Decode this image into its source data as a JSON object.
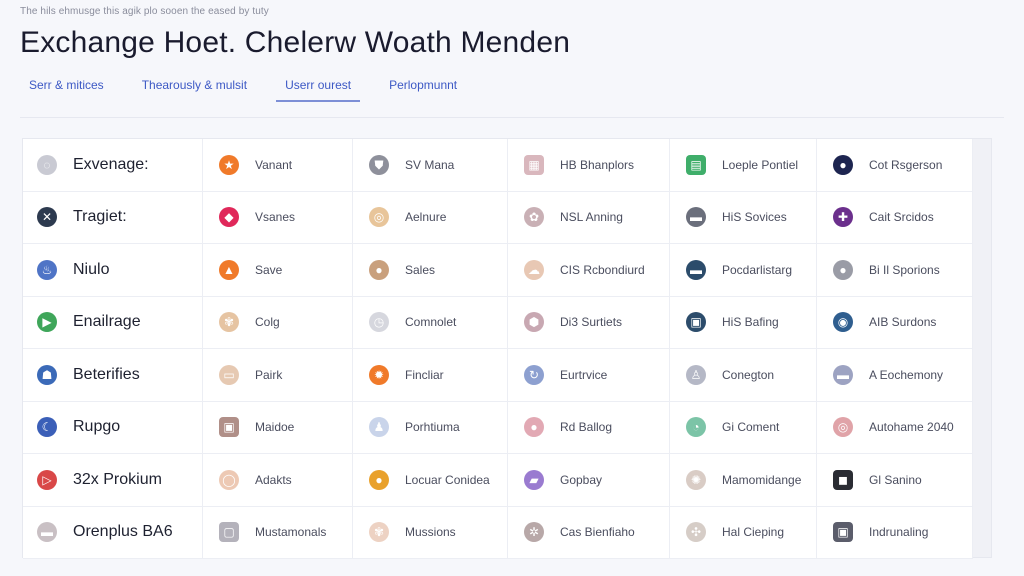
{
  "header": {
    "breadcrumb": "The hils ehmusge this agik plo sooen the eased by tuty",
    "title": "Exchange Hoet. Chelerw Woath Menden"
  },
  "tabs": [
    {
      "label": "Serr & mitices",
      "active": false
    },
    {
      "label": "Thearously & mulsit",
      "active": false
    },
    {
      "label": "Userr ourest",
      "active": true
    },
    {
      "label": "Perlopmunnt",
      "active": false
    }
  ],
  "colors": {
    "accent": "#3d59c5",
    "tab_underline": "#7d8fd6",
    "background": "#f6f7fb",
    "cell": "#ffffff"
  },
  "rows": [
    [
      {
        "label": "Exvenage:",
        "icon": "spinner-icon",
        "color": "#c9cad3",
        "glyph": "◌"
      },
      {
        "label": "Vanant",
        "icon": "star-icon",
        "color": "#f07a2a",
        "glyph": "★"
      },
      {
        "label": "SV Mana",
        "icon": "shield-icon",
        "color": "#8e909b",
        "glyph": "⛊"
      },
      {
        "label": "HB Bhanplors",
        "icon": "grid-icon",
        "color": "#d9b7bd",
        "glyph": "▦"
      },
      {
        "label": "Loeple Pontiel",
        "icon": "document-icon",
        "color": "#3fae6a",
        "glyph": "▤"
      },
      {
        "label": "Cot Rsgerson",
        "icon": "globe-icon",
        "color": "#1d2550",
        "glyph": "●"
      }
    ],
    [
      {
        "label": "Tragiet:",
        "icon": "close-circle-icon",
        "color": "#2d3a4f",
        "glyph": "✕"
      },
      {
        "label": "Vsanes",
        "icon": "gem-icon",
        "color": "#e0285a",
        "glyph": "◆"
      },
      {
        "label": "Aelnure",
        "icon": "compass-icon",
        "color": "#e8c59a",
        "glyph": "◎"
      },
      {
        "label": "NSL Anning",
        "icon": "badge-icon",
        "color": "#c9b0b5",
        "glyph": "✿"
      },
      {
        "label": "HiS Sovices",
        "icon": "pill-icon",
        "color": "#6b6f7c",
        "glyph": "▬"
      },
      {
        "label": "Cait Srcidos",
        "icon": "puzzle-icon",
        "color": "#6b2f8c",
        "glyph": "✚"
      }
    ],
    [
      {
        "label": "Niulo",
        "icon": "leaf-icon",
        "color": "#4f74c6",
        "glyph": "♨"
      },
      {
        "label": "Save",
        "icon": "triangle-icon",
        "color": "#f07a2a",
        "glyph": "▲"
      },
      {
        "label": "Sales",
        "icon": "coin-icon",
        "color": "#c9a07d",
        "glyph": "●"
      },
      {
        "label": "CIS Rcbondiurd",
        "icon": "cloud-icon",
        "color": "#e8c8b4",
        "glyph": "☁"
      },
      {
        "label": "Pocdarlistarg",
        "icon": "disc-icon",
        "color": "#2c4c6b",
        "glyph": "▬"
      },
      {
        "label": "Bi Il Sporions",
        "icon": "circle-icon",
        "color": "#9a9ca6",
        "glyph": "●"
      }
    ],
    [
      {
        "label": "Enailrage",
        "icon": "play-icon",
        "color": "#3fa65a",
        "glyph": "▶"
      },
      {
        "label": "Colg",
        "icon": "flower-icon",
        "color": "#e6c4a2",
        "glyph": "✾"
      },
      {
        "label": "Comnolet",
        "icon": "clock-icon",
        "color": "#d6d7de",
        "glyph": "◷"
      },
      {
        "label": "Di3 Surtiets",
        "icon": "hexagon-icon",
        "color": "#c8a8b2",
        "glyph": "⬢"
      },
      {
        "label": "HiS Bafing",
        "icon": "chip-icon",
        "color": "#2c4c6b",
        "glyph": "▣"
      },
      {
        "label": "AIB Surdons",
        "icon": "eye-icon",
        "color": "#2f5e8f",
        "glyph": "◉"
      }
    ],
    [
      {
        "label": "Beterifies",
        "icon": "robot-icon",
        "color": "#3b6ab8",
        "glyph": "☗"
      },
      {
        "label": "Pairk",
        "icon": "ticket-icon",
        "color": "#e6c9b2",
        "glyph": "▭"
      },
      {
        "label": "Fincliar",
        "icon": "sun-icon",
        "color": "#f07a2a",
        "glyph": "✹"
      },
      {
        "label": "Eurtrvice",
        "icon": "refresh-icon",
        "color": "#8da0d0",
        "glyph": "↻"
      },
      {
        "label": "Conegton",
        "icon": "person-icon",
        "color": "#b5b8c6",
        "glyph": "♙"
      },
      {
        "label": "A Eochemony",
        "icon": "car-icon",
        "color": "#9da3c2",
        "glyph": "▬"
      }
    ],
    [
      {
        "label": "Rupgo",
        "icon": "moon-icon",
        "color": "#3b5fb8",
        "glyph": "☾"
      },
      {
        "label": "Maidoe",
        "icon": "box-icon",
        "color": "#b08f88",
        "glyph": "▣"
      },
      {
        "label": "Porhtiuma",
        "icon": "bell-icon",
        "color": "#c9d4ea",
        "glyph": "♟"
      },
      {
        "label": "Rd Ballog",
        "icon": "dot-icon",
        "color": "#e2a9b4",
        "glyph": "●"
      },
      {
        "label": "Gi Coment",
        "icon": "chart-icon",
        "color": "#7cc4a7",
        "glyph": "◔"
      },
      {
        "label": "Autohame 2040",
        "icon": "target-icon",
        "color": "#e0a3a8",
        "glyph": "◎"
      }
    ],
    [
      {
        "label": "32x Prokium",
        "icon": "play-outline-icon",
        "color": "#d94848",
        "glyph": "▷"
      },
      {
        "label": "Adakts",
        "icon": "ring-icon",
        "color": "#edc9b4",
        "glyph": "◯"
      },
      {
        "label": "Locuar Conidea",
        "icon": "lightbulb-icon",
        "color": "#e9a12c",
        "glyph": "●"
      },
      {
        "label": "Gopbay",
        "icon": "folder-icon",
        "color": "#9a7bd0",
        "glyph": "▰"
      },
      {
        "label": "Mamomidange",
        "icon": "settings-icon",
        "color": "#d9ccc5",
        "glyph": "✺"
      },
      {
        "label": "Gl Sanino",
        "icon": "cube-icon",
        "color": "#2a2c33",
        "glyph": "◼"
      }
    ],
    [
      {
        "label": "Orenplus BA6",
        "icon": "pill-icon",
        "color": "#c9c0c4",
        "glyph": "▬"
      },
      {
        "label": "Mustamonals",
        "icon": "square-icon",
        "color": "#b4b2bb",
        "glyph": "▢"
      },
      {
        "label": "Mussions",
        "icon": "flower-icon",
        "color": "#edd2c3",
        "glyph": "✾"
      },
      {
        "label": "Cas Bienfiaho",
        "icon": "gear-icon",
        "color": "#b8a8a8",
        "glyph": "✲"
      },
      {
        "label": "Hal Cieping",
        "icon": "crosshair-icon",
        "color": "#d6cdc7",
        "glyph": "✣"
      },
      {
        "label": "Indrunaling",
        "icon": "monitor-icon",
        "color": "#5b5d6b",
        "glyph": "▣"
      }
    ]
  ]
}
